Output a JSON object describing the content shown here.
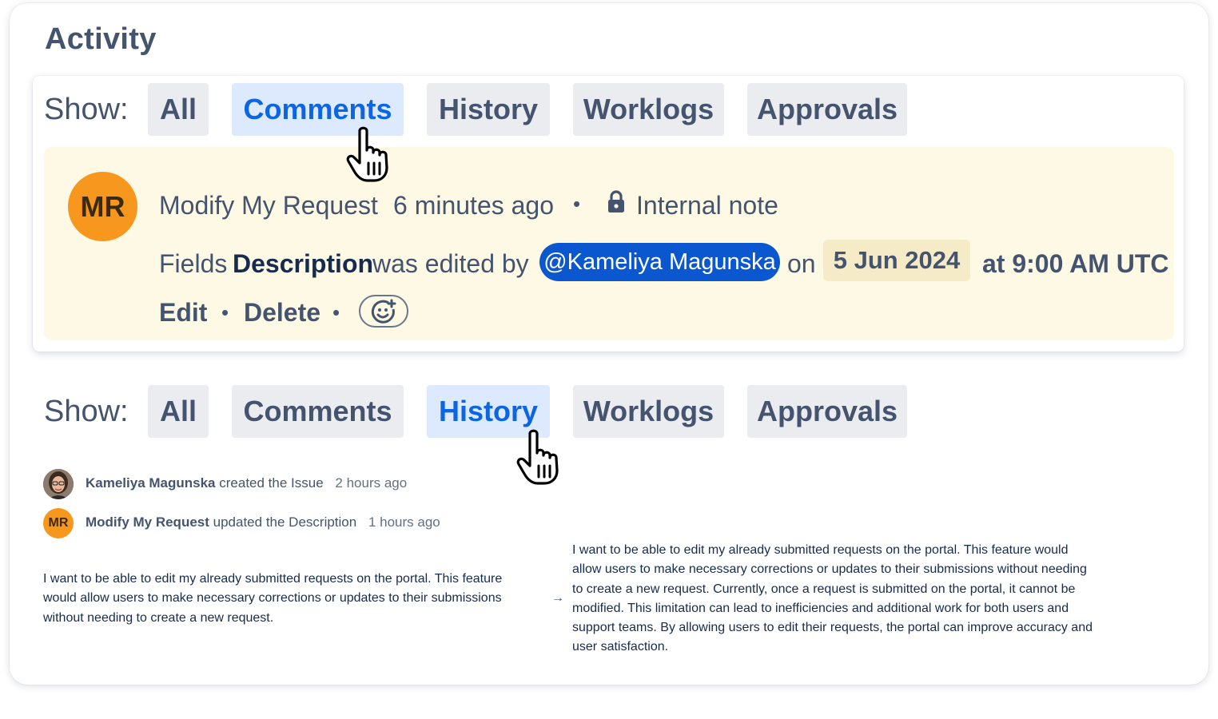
{
  "title": "Activity",
  "filter_label": "Show:",
  "filters": [
    "All",
    "Comments",
    "History",
    "Worklogs",
    "Approvals"
  ],
  "panel_top": {
    "active_filter": "Comments"
  },
  "panel_bottom": {
    "active_filter": "History"
  },
  "comment": {
    "avatar_initials": "MR",
    "author": "Modify My Request",
    "time": "6 minutes ago",
    "separator": "•",
    "visibility": "Internal note",
    "body": {
      "prefix": "Fields",
      "field": "Description",
      "middle": "was edited by",
      "mention": "@Kameliya Magunska",
      "on": "on",
      "date": "5 Jun 2024",
      "time": "at 9:00 AM UTC"
    },
    "actions": {
      "edit": "Edit",
      "delete": "Delete"
    }
  },
  "history": [
    {
      "author": "Kameliya Magunska",
      "action": "created the Issue",
      "time": "2 hours ago"
    },
    {
      "avatar_initials": "MR",
      "author": "Modify My Request",
      "action": "updated the Description",
      "time": "1 hours ago"
    }
  ],
  "diff": {
    "old": "I want to be able to edit my already submitted requests on the portal. This feature would allow users to make necessary corrections or updates to their submissions without needing to create a new request.",
    "arrow": "→",
    "new": "I want to be able to edit my already submitted requests on the portal. This feature would allow users to make necessary corrections or updates to their submissions without needing to create a new request. Currently, once a request is submitted on the portal, it cannot be modified. This limitation can lead to inefficiencies and additional work for both users and support teams. By allowing users to edit their requests, the portal can improve accuracy and user satisfaction."
  },
  "colors": {
    "accent": "#0c66e4",
    "active_chip_bg": "#dde9fd",
    "chip_bg": "#ebecf0",
    "note_bg": "#fef9e4",
    "avatar": "#f8971d",
    "mention_bg": "#0b57d0"
  },
  "icons": {
    "lock": "lock-icon",
    "reaction": "add-reaction-icon",
    "cursor": "hand-pointer-icon"
  }
}
